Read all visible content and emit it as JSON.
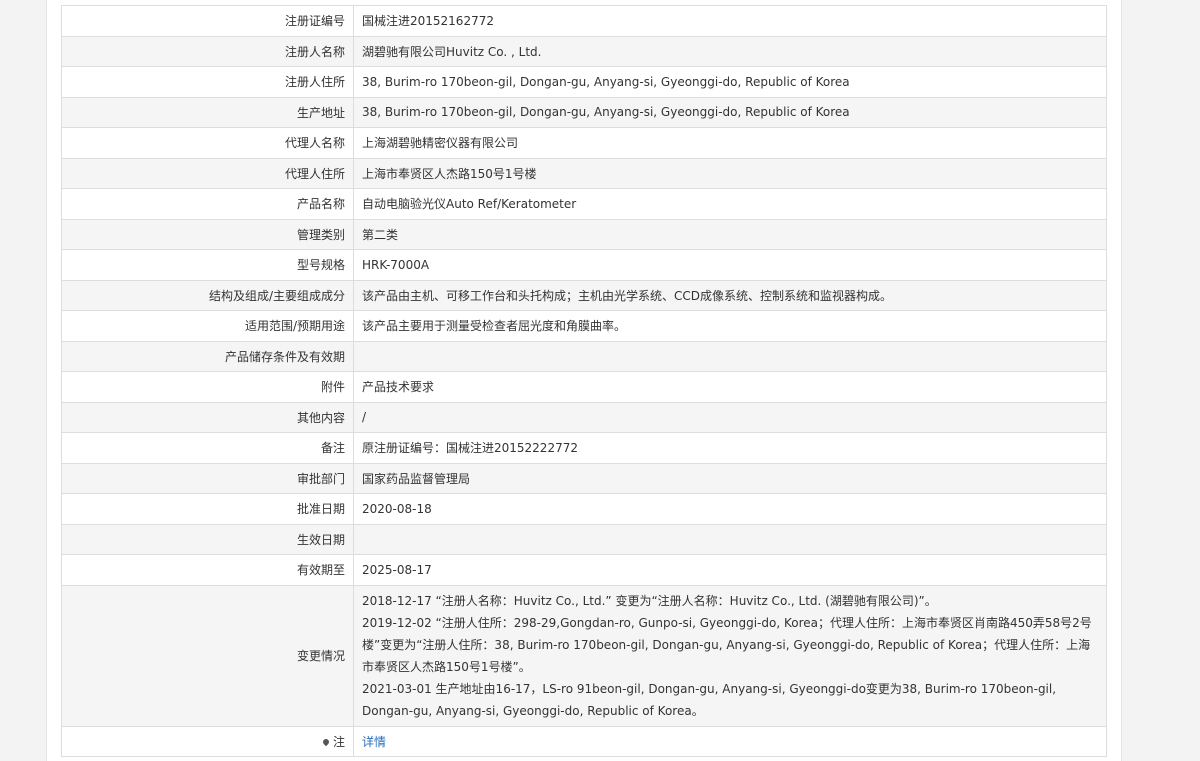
{
  "rows": [
    {
      "label": "注册证编号",
      "value": "国械注进20152162772"
    },
    {
      "label": "注册人名称",
      "value": "湖碧驰有限公司Huvitz Co. , Ltd."
    },
    {
      "label": "注册人住所",
      "value": "38, Burim-ro 170beon-gil, Dongan-gu, Anyang-si, Gyeonggi-do, Republic of Korea"
    },
    {
      "label": "生产地址",
      "value": "38, Burim-ro 170beon-gil, Dongan-gu, Anyang-si, Gyeonggi-do, Republic of Korea"
    },
    {
      "label": "代理人名称",
      "value": "上海湖碧驰精密仪器有限公司"
    },
    {
      "label": "代理人住所",
      "value": "上海市奉贤区人杰路150号1号楼"
    },
    {
      "label": "产品名称",
      "value": "自动电脑验光仪Auto Ref/Keratometer"
    },
    {
      "label": "管理类别",
      "value": "第二类"
    },
    {
      "label": "型号规格",
      "value": "HRK-7000A"
    },
    {
      "label": "结构及组成/主要组成成分",
      "value": "该产品由主机、可移工作台和头托构成；主机由光学系统、CCD成像系统、控制系统和监视器构成。"
    },
    {
      "label": "适用范围/预期用途",
      "value": "该产品主要用于测量受检查者屈光度和角膜曲率。"
    },
    {
      "label": "产品储存条件及有效期",
      "value": ""
    },
    {
      "label": "附件",
      "value": "产品技术要求"
    },
    {
      "label": "其他内容",
      "value": "/"
    },
    {
      "label": "备注",
      "value": "原注册证编号：国械注进20152222772"
    },
    {
      "label": "审批部门",
      "value": "国家药品监督管理局"
    },
    {
      "label": "批准日期",
      "value": "2020-08-18"
    },
    {
      "label": "生效日期",
      "value": ""
    },
    {
      "label": "有效期至",
      "value": "2025-08-17"
    }
  ],
  "changes": {
    "label": "变更情况",
    "entries": [
      "2018-12-17 “注册人名称：Huvitz Co., Ltd.” 变更为“注册人名称：Huvitz Co., Ltd. (湖碧驰有限公司)”。",
      "2019-12-02 “注册人住所：298-29,Gongdan-ro, Gunpo-si, Gyeonggi-do, Korea；代理人住所：上海市奉贤区肖南路450弄58号2号楼”变更为“注册人住所：38, Burim-ro 170beon-gil, Dongan-gu, Anyang-si, Gyeonggi-do, Republic of Korea；代理人住所：上海市奉贤区人杰路150号1号楼”。",
      "2021-03-01 生产地址由16-17，LS-ro 91beon-gil, Dongan-gu, Anyang-si, Gyeonggi-do变更为38, Burim-ro 170beon-gil, Dongan-gu, Anyang-si, Gyeonggi-do, Republic of Korea。"
    ]
  },
  "note": {
    "icon": "location-pin-icon",
    "label": "注",
    "link_text": "详情",
    "link_color": "#2a6ebb"
  }
}
